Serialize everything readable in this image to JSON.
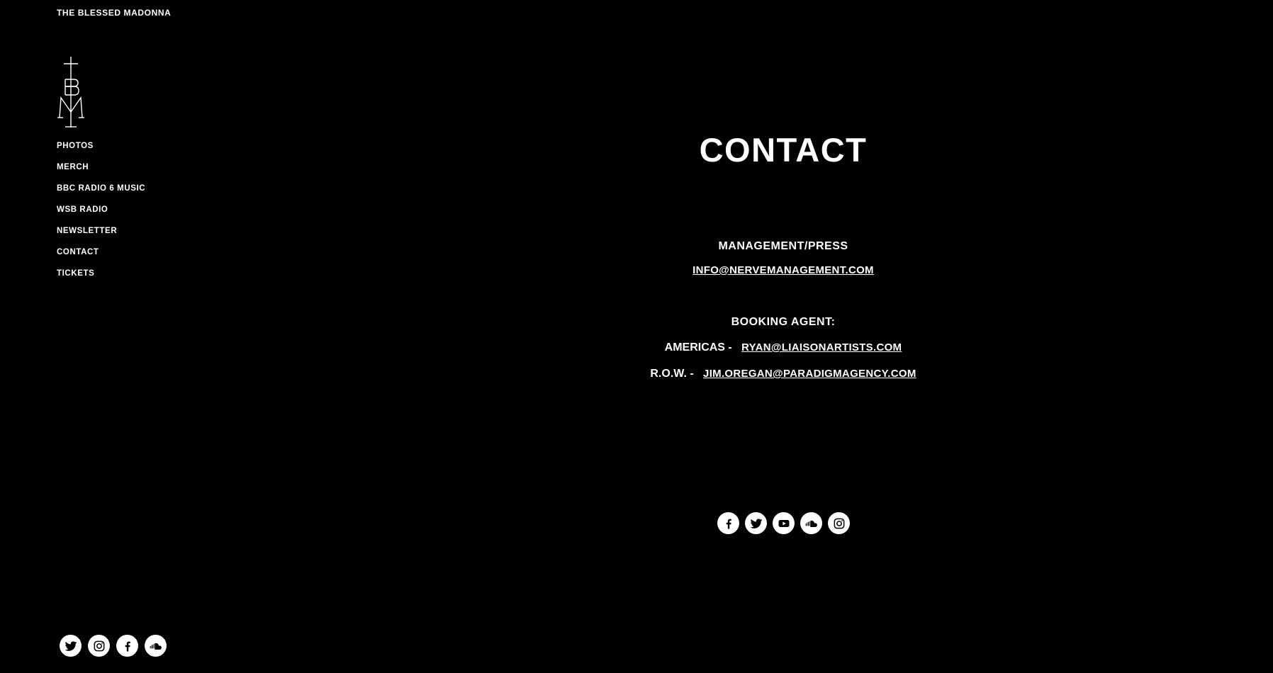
{
  "site": {
    "title": "THE BLESSED MADONNA"
  },
  "nav": {
    "items": [
      {
        "label": "PHOTOS"
      },
      {
        "label": "MERCH"
      },
      {
        "label": "BBC RADIO 6 MUSIC"
      },
      {
        "label": "WSB RADIO"
      },
      {
        "label": "NEWSLETTER"
      },
      {
        "label": "CONTACT"
      },
      {
        "label": "TICKETS"
      }
    ]
  },
  "contact": {
    "heading": "CONTACT",
    "management": {
      "label": "MANAGEMENT/PRESS",
      "email": "INFO@NERVEMANAGEMENT.COM"
    },
    "booking": {
      "label": "BOOKING AGENT:",
      "americas_label": "AMERICAS -",
      "americas_email": "RYAN@LIAISONARTISTS.COM",
      "row_label": "R.O.W. -",
      "row_email": "JIM.OREGAN@PARADIGMAGENCY.COM"
    }
  },
  "main_social": [
    "facebook-icon",
    "twitter-icon",
    "youtube-icon",
    "soundcloud-icon",
    "instagram-icon"
  ],
  "sidebar_social": [
    "twitter-icon",
    "instagram-icon",
    "facebook-icon",
    "soundcloud-icon"
  ],
  "colors": {
    "background": "#000000",
    "foreground": "#ffffff"
  }
}
